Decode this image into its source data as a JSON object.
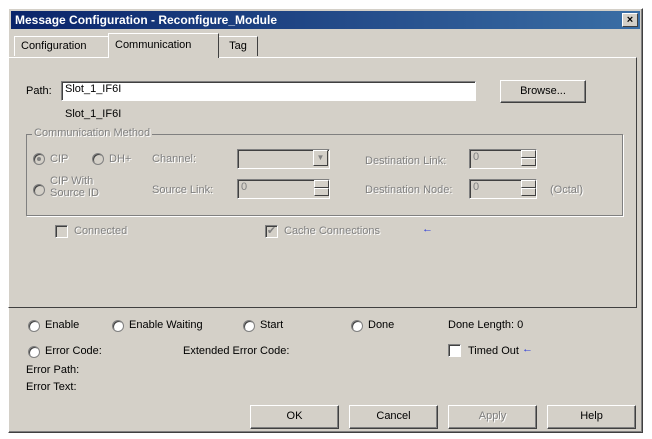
{
  "window": {
    "title": "Message Configuration - Reconfigure_Module",
    "close_glyph": "×"
  },
  "tabs": [
    {
      "label": "Configuration",
      "active": false
    },
    {
      "label": "Communication",
      "active": true
    },
    {
      "label": "Tag",
      "active": false
    }
  ],
  "path": {
    "label": "Path:",
    "value": "Slot_1_IF6I",
    "resolved": "Slot_1_IF6I",
    "browse_label": "Browse..."
  },
  "comm_method": {
    "group_label": "Communication Method",
    "cip_label": "CIP",
    "dhplus_label": "DH+",
    "cip_source_label_1": "CIP With",
    "cip_source_label_2": "Source ID",
    "channel_label": "Channel:",
    "channel_value": "",
    "dest_link_label": "Destination Link:",
    "dest_link_value": "0",
    "source_link_label": "Source Link:",
    "source_link_value": "0",
    "dest_node_label": "Destination Node:",
    "dest_node_value": "0",
    "octal_label": "(Octal)"
  },
  "options": {
    "connected_label": "Connected",
    "connected_checked": false,
    "cache_label": "Cache Connections",
    "cache_checked": true,
    "cache_check_glyph": "✔",
    "arrow_glyph": "←"
  },
  "status": {
    "enable_label": "Enable",
    "enable_waiting_label": "Enable Waiting",
    "start_label": "Start",
    "done_label": "Done",
    "done_length_label": "Done Length: 0",
    "error_code_label": "Error Code:",
    "extended_error_label": "Extended Error Code:",
    "timed_out_label": "Timed Out",
    "error_path_label": "Error Path:",
    "error_text_label": "Error Text:"
  },
  "buttons": {
    "ok": "OK",
    "cancel": "Cancel",
    "apply": "Apply",
    "help": "Help"
  },
  "colors": {
    "title_start": "#0a246a",
    "title_end": "#3a6ea5",
    "face": "#d4d0c8",
    "arrow": "#2a3ad8"
  }
}
